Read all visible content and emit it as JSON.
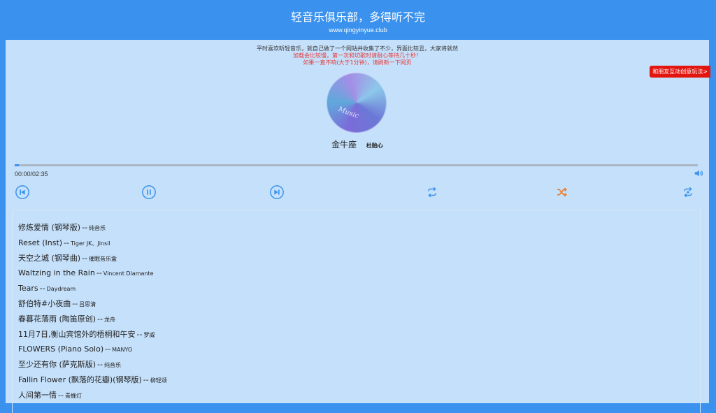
{
  "header": {
    "title": "轻音乐俱乐部，多得听不完",
    "url": "www.qingyinyue.club"
  },
  "notices": [
    "平时喜欢听轻音乐，就自己做了一个网站并收集了不少，界面比较丑，大家将就然",
    "加载会比较慢，第一次和切歌时请耐心等待几十秒！",
    "如果一直不响(大于1分钟)，请刷新一下网页"
  ],
  "player": {
    "disc_label": "Music",
    "song_title": "金牛座",
    "song_artist": "杜贻心",
    "time": "00:00/02:35",
    "progress": 0.006
  },
  "popout_tab": "和朋友互动创意玩法>",
  "playlist": {
    "separator": "--",
    "items": [
      {
        "title": "修炼爱情 (钢琴版)",
        "artist": "纯音乐"
      },
      {
        "title": "Reset (Inst)",
        "artist": "Tiger JK、Jinsil"
      },
      {
        "title": "天空之城 (钢琴曲)",
        "artist": "催眠音乐盒"
      },
      {
        "title": "Waltzing in the Rain",
        "artist": "Vincent Diamante"
      },
      {
        "title": "Tears",
        "artist": "Daydream"
      },
      {
        "title": "舒伯特#小夜曲",
        "artist": "吕思清"
      },
      {
        "title": "春暮花落雨 (陶笛原创)",
        "artist": "龙舟"
      },
      {
        "title": "11月7日,衡山宾馆外的梧桐和午安",
        "artist": "罗威"
      },
      {
        "title": "FLOWERS (Piano Solo)",
        "artist": "MANYO"
      },
      {
        "title": "至少还有你 (萨克斯版)",
        "artist": "纯音乐"
      },
      {
        "title": "Fallin Flower (飘落的花瓣)(钢琴版)",
        "artist": "柳轻颂"
      },
      {
        "title": "人间第一情",
        "artist": "青蜂灯"
      }
    ]
  },
  "colors": {
    "header_bg": "#3a92ee",
    "panel_bg": "#c5e0fa",
    "control": "#3a92ee",
    "shuffle": "#ee7722",
    "warning_text": "#e63c3c",
    "tab_bg": "#e3150f"
  }
}
